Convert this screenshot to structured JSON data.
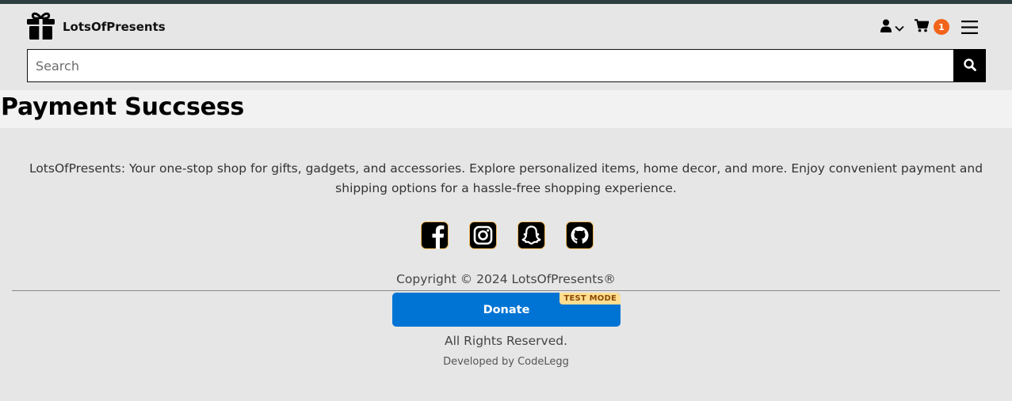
{
  "header": {
    "brand_name": "LotsOfPresents",
    "cart_count": "1",
    "icons": [
      "gift-icon",
      "user-icon",
      "chevron-down-icon",
      "cart-icon",
      "hamburger-menu-icon",
      "search-icon"
    ],
    "colors": {
      "badge": "#f26419",
      "top_bar": "#2c3e3f"
    }
  },
  "search": {
    "placeholder": "Search",
    "value": ""
  },
  "main": {
    "title": "Payment Succsess"
  },
  "footer": {
    "about": "LotsOfPresents: Your one-stop shop for gifts, gadgets, and accessories. Explore personalized items, home decor, and more. Enjoy convenient payment and shipping options for a hassle-free shopping experience.",
    "social_icons": [
      "facebook-icon",
      "instagram-icon",
      "snapchat-icon",
      "github-icon"
    ],
    "copyright": "Copyright © 2024 LotsOfPresents®",
    "donate_label": "Donate",
    "test_mode_label": "TEST MODE",
    "rights": "All Rights Reserved.",
    "developer": "Developed by CodeLegg",
    "colors": {
      "donate": "#0074d4",
      "test_mode": "#ffde92"
    }
  }
}
